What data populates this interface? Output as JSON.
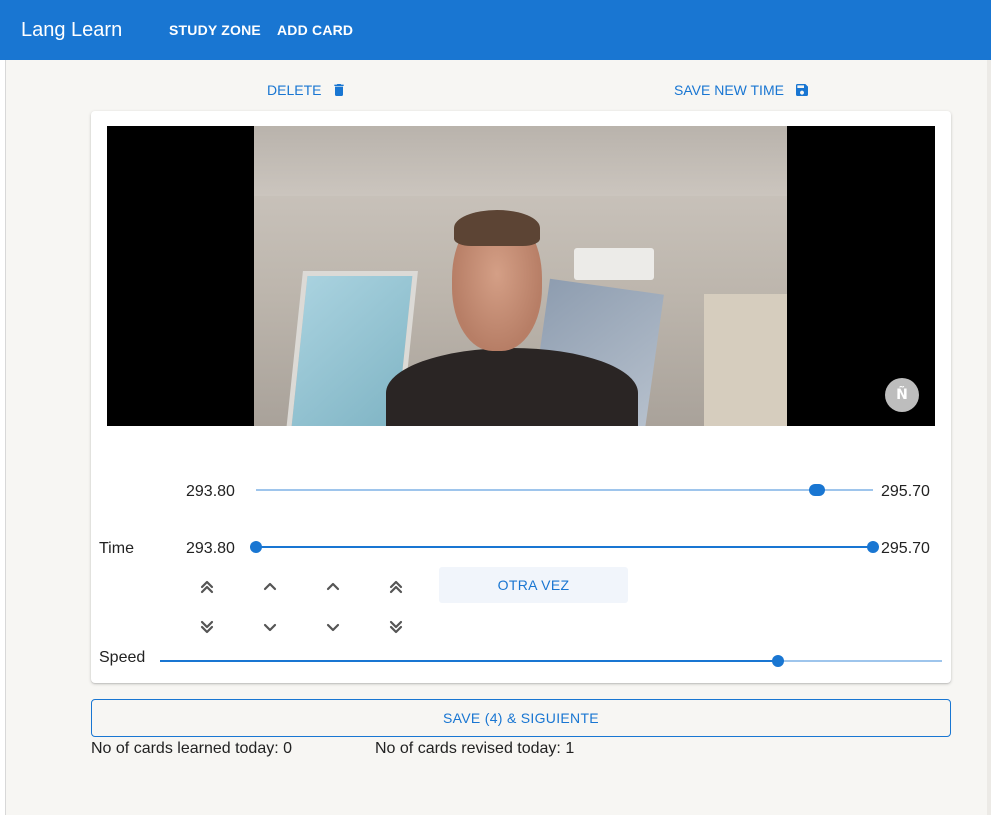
{
  "app_bar": {
    "title": "Lang Learn",
    "nav": [
      {
        "label": "STUDY ZONE"
      },
      {
        "label": "ADD CARD"
      }
    ],
    "color": "#1976d2"
  },
  "toolbar": {
    "delete_label": "DELETE",
    "save_time_label": "SAVE NEW TIME"
  },
  "video": {
    "watermark": "Ñ"
  },
  "range_slider": {
    "start_value": "293.80",
    "end_value": "295.70",
    "thumb_fraction": 0.91
  },
  "time_slider": {
    "label": "Time",
    "start_value": "293.80",
    "end_value": "295.70",
    "start_fraction": 0.0,
    "end_fraction": 1.0
  },
  "controls": {
    "otra_vez_label": "OTRA VEZ",
    "up_icons": [
      "double-chevron-up-icon",
      "chevron-up-icon",
      "chevron-up-icon",
      "double-chevron-up-icon"
    ],
    "down_icons": [
      "double-chevron-down-icon",
      "chevron-down-icon",
      "chevron-down-icon",
      "double-chevron-down-icon"
    ]
  },
  "speed_slider": {
    "label": "Speed",
    "fraction": 0.79
  },
  "save_next_label": "SAVE (4) & SIGUIENTE",
  "stats": {
    "learned_today": "No of cards learned today: 0",
    "revised_today": "No of cards revised today: 1"
  }
}
